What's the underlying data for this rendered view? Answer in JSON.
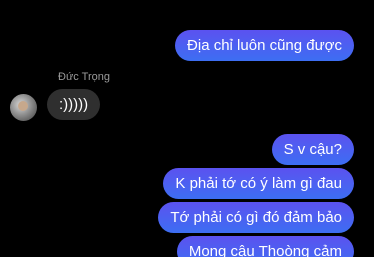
{
  "reactions": [
    "😰",
    "😰",
    "😰"
  ],
  "thread": {
    "out_msg_1": "Địa chỉ luôn cũng được",
    "sender_name": "Đức Trọng",
    "in_msg_1": ":)))))",
    "out_msg_2": "S v cậu?",
    "out_msg_3": "K phải tớ có ý làm gì đau",
    "out_msg_4": "Tớ phải có gì đó đảm bảo",
    "out_msg_5": "Mong cậu Thoòng cảm"
  },
  "colors": {
    "background": "#000000",
    "outgoing_bubble_top": "#5b52f0",
    "outgoing_bubble_bottom": "#3d6ef2",
    "incoming_bubble": "#2f2f2f",
    "sender_name": "#9a9a9a"
  }
}
